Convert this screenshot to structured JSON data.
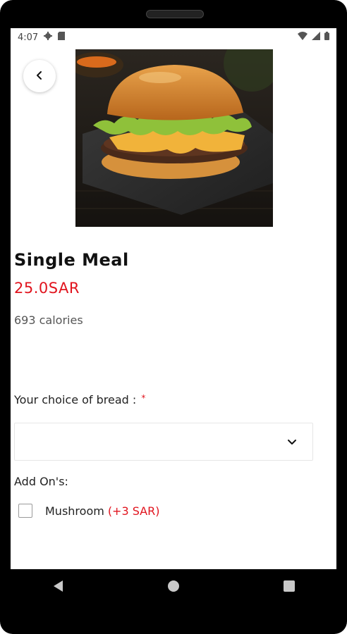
{
  "status_bar": {
    "time": "4:07",
    "left_icons": [
      "settings-icon",
      "sim-card-icon"
    ],
    "right_icons": [
      "wifi-icon",
      "signal-icon",
      "battery-icon"
    ]
  },
  "product": {
    "title": "Single Meal",
    "price": "25.0SAR",
    "calories": "693 calories",
    "image": "burger-photo"
  },
  "bread": {
    "label": "Your choice of bread :",
    "required_marker": "*",
    "selected_value": ""
  },
  "addons": {
    "label": "Add On's:",
    "items": [
      {
        "name": "Mushroom",
        "price": "(+3 SAR)",
        "checked": false
      }
    ]
  },
  "nav": {
    "buttons": [
      "back-triangle-icon",
      "home-circle-icon",
      "recents-square-icon"
    ]
  },
  "colors": {
    "accent": "#e1141e",
    "text": "#111111",
    "muted": "#555555"
  }
}
